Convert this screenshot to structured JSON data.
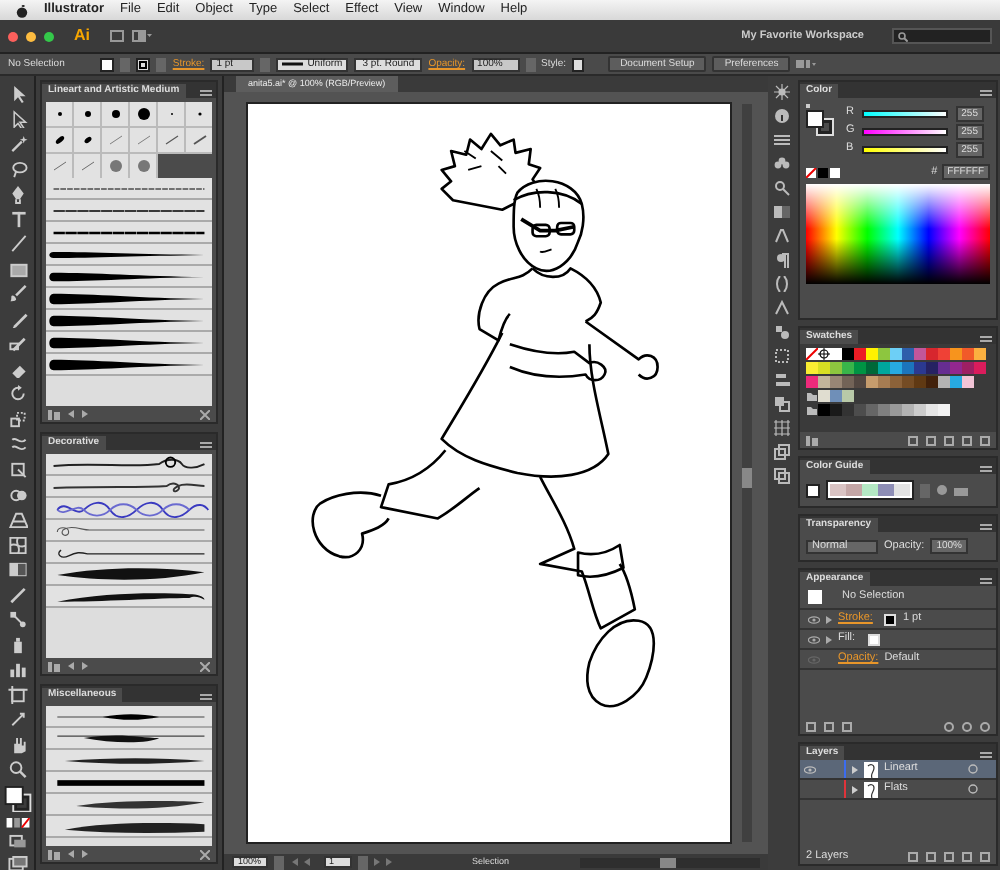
{
  "menu_bar": {
    "app": "Illustrator",
    "items": [
      "File",
      "Edit",
      "Object",
      "Type",
      "Select",
      "Effect",
      "View",
      "Window",
      "Help"
    ]
  },
  "app_bar": {
    "logo": "Ai",
    "workspace": "My Favorite Workspace"
  },
  "control_bar": {
    "selection": "No Selection",
    "stroke_label": "Stroke:",
    "stroke_weight": "1 pt",
    "profile": "Uniform",
    "brush": "3 pt. Round",
    "opacity_label": "Opacity:",
    "opacity": "100%",
    "style_label": "Style:",
    "buttons": [
      "Document Setup",
      "Preferences"
    ]
  },
  "brush_panels": [
    {
      "title": "Lineart and Artistic Medium",
      "kind": "lineart"
    },
    {
      "title": "Decorative",
      "kind": "decorative"
    },
    {
      "title": "Miscellaneous",
      "kind": "misc"
    }
  ],
  "document": {
    "tab": "anita5.ai* @ 100% (RGB/Preview)"
  },
  "status_bar": {
    "zoom": "100%",
    "artboard": "1",
    "tool": "Selection"
  },
  "color_panel": {
    "title": "Color",
    "channels": [
      {
        "label": "R",
        "value": "255",
        "level": 1
      },
      {
        "label": "G",
        "value": "255",
        "level": 1
      },
      {
        "label": "B",
        "value": "255",
        "level": 1
      }
    ],
    "hex_label": "#",
    "hex": "FFFFFF"
  },
  "swatches": {
    "title": "Swatches",
    "rows": [
      [
        {
          "kind": "none"
        },
        {
          "kind": "registration"
        },
        {
          "kind": "color",
          "color": "#ffffff"
        },
        {
          "kind": "color",
          "color": "#000000"
        },
        {
          "kind": "color",
          "color": "#ed1c24"
        },
        {
          "kind": "color",
          "color": "#fff200"
        },
        {
          "kind": "color",
          "color": "#8dc63f"
        },
        {
          "kind": "color",
          "color": "#6dcff6"
        },
        {
          "kind": "color",
          "color": "#2e5fab"
        },
        {
          "kind": "color",
          "color": "#c2569b"
        },
        {
          "kind": "color",
          "color": "#d7262e"
        },
        {
          "kind": "color",
          "color": "#ef4136"
        },
        {
          "kind": "color",
          "color": "#f7941d"
        },
        {
          "kind": "color",
          "color": "#f15a29"
        },
        {
          "kind": "color",
          "color": "#fbb040"
        }
      ],
      [
        {
          "kind": "color",
          "color": "#f9ed32"
        },
        {
          "kind": "color",
          "color": "#d7df23"
        },
        {
          "kind": "color",
          "color": "#8dc63f"
        },
        {
          "kind": "color",
          "color": "#39b54a"
        },
        {
          "kind": "color",
          "color": "#009444"
        },
        {
          "kind": "color",
          "color": "#006838"
        },
        {
          "kind": "color",
          "color": "#00a79d"
        },
        {
          "kind": "color",
          "color": "#27aae1"
        },
        {
          "kind": "color",
          "color": "#1c75bc"
        },
        {
          "kind": "color",
          "color": "#2b3990"
        },
        {
          "kind": "color",
          "color": "#262262"
        },
        {
          "kind": "color",
          "color": "#662d91"
        },
        {
          "kind": "color",
          "color": "#92278f"
        },
        {
          "kind": "color",
          "color": "#9e1f63"
        },
        {
          "kind": "color",
          "color": "#da1c5c"
        }
      ],
      [
        {
          "kind": "color",
          "color": "#ee2a7b"
        },
        {
          "kind": "color",
          "color": "#c2b59b"
        },
        {
          "kind": "color",
          "color": "#998675"
        },
        {
          "kind": "color",
          "color": "#736357"
        },
        {
          "kind": "color",
          "color": "#534741"
        },
        {
          "kind": "color",
          "color": "#c69c6d"
        },
        {
          "kind": "color",
          "color": "#a67c52"
        },
        {
          "kind": "color",
          "color": "#8c6239"
        },
        {
          "kind": "color",
          "color": "#754c24"
        },
        {
          "kind": "color",
          "color": "#603913"
        },
        {
          "kind": "color",
          "color": "#42210b"
        },
        {
          "kind": "color",
          "color": "#b3b3b3"
        },
        {
          "kind": "color",
          "color": "#27aae1"
        },
        {
          "kind": "color",
          "color": "#f2c4d6"
        }
      ],
      [
        {
          "kind": "folder"
        },
        {
          "kind": "color",
          "color": "#e0ddd0"
        },
        {
          "kind": "color",
          "color": "#6f8fb8"
        },
        {
          "kind": "color",
          "color": "#b8c9a8"
        }
      ],
      [
        {
          "kind": "folder"
        },
        {
          "kind": "color",
          "color": "#000000"
        },
        {
          "kind": "color",
          "color": "#1a1a1a"
        },
        {
          "kind": "color",
          "color": "#333333"
        },
        {
          "kind": "color",
          "color": "#4d4d4d"
        },
        {
          "kind": "color",
          "color": "#666666"
        },
        {
          "kind": "color",
          "color": "#808080"
        },
        {
          "kind": "color",
          "color": "#999999"
        },
        {
          "kind": "color",
          "color": "#b3b3b3"
        },
        {
          "kind": "color",
          "color": "#cccccc"
        },
        {
          "kind": "color",
          "color": "#e6e6e6"
        },
        {
          "kind": "color",
          "color": "#f2f2f2"
        }
      ]
    ]
  },
  "color_guide": {
    "title": "Color Guide",
    "colors": [
      {
        "color": "#d9c3c3"
      },
      {
        "color": "#c4a6a6"
      },
      {
        "color": "#b4e8c4"
      },
      {
        "color": "#8e8eb6"
      },
      {
        "color": "#e2e2e2"
      }
    ]
  },
  "transparency": {
    "title": "Transparency",
    "blend_mode": "Normal",
    "opacity_label": "Opacity:",
    "opacity": "100%"
  },
  "appearance": {
    "title": "Appearance",
    "target": "No Selection",
    "rows": [
      {
        "kind": "stroke",
        "label": "Stroke:",
        "value": "1 pt"
      },
      {
        "kind": "fill",
        "label": "Fill:"
      },
      {
        "kind": "opacity",
        "label": "Opacity:",
        "value": "Default"
      }
    ]
  },
  "layers": {
    "title": "Layers",
    "items": [
      {
        "name": "Lineart",
        "visible": true,
        "selected": true,
        "color": "#3b6cf0"
      },
      {
        "name": "Flats",
        "visible": false,
        "selected": false,
        "color": "#e0333a"
      }
    ],
    "count": "2 Layers"
  }
}
